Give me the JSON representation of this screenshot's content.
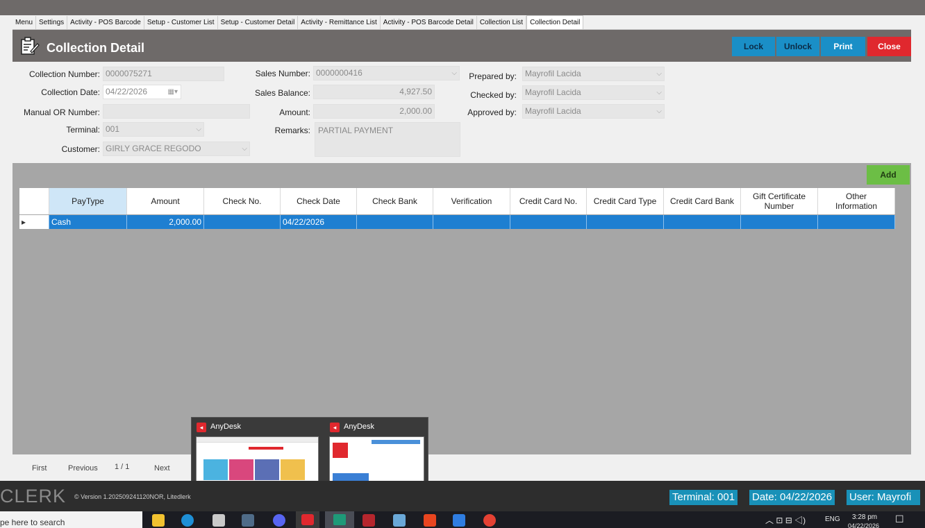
{
  "tabs": [
    "Menu",
    "Settings",
    "Activity - POS Barcode",
    "Setup - Customer List",
    "Setup - Customer Detail",
    "Activity - Remittance List",
    "Activity - POS Barcode Detail",
    "Collection List",
    "Collection Detail"
  ],
  "header": {
    "title": "Collection Detail",
    "buttons": {
      "lock": "Lock",
      "unlock": "Unlock",
      "print": "Print",
      "close": "Close"
    },
    "colors": {
      "lock": "#1a8fc7",
      "close": "#e0282e"
    }
  },
  "form": {
    "collection_number": {
      "label": "Collection Number:",
      "value": "0000075271"
    },
    "collection_date": {
      "label": "Collection Date:",
      "value": "04/22/2026"
    },
    "manual_or_number": {
      "label": "Manual OR Number:",
      "value": ""
    },
    "terminal": {
      "label": "Terminal:",
      "value": "001"
    },
    "customer": {
      "label": "Customer:",
      "value": "GIRLY GRACE REGODO"
    },
    "sales_number": {
      "label": "Sales Number:",
      "value": "0000000416"
    },
    "sales_balance": {
      "label": "Sales Balance:",
      "value": "4,927.50"
    },
    "amount": {
      "label": "Amount:",
      "value": "2,000.00"
    },
    "remarks": {
      "label": "Remarks:",
      "value": "PARTIAL PAYMENT"
    },
    "prepared_by": {
      "label": "Prepared by:",
      "value": "Mayrofil Lacida"
    },
    "checked_by": {
      "label": "Checked by:",
      "value": "Mayrofil Lacida"
    },
    "approved_by": {
      "label": "Approved by:",
      "value": "Mayrofil Lacida"
    }
  },
  "grid": {
    "add_label": "Add",
    "columns": [
      "PayType",
      "Amount",
      "Check No.",
      "Check Date",
      "Check Bank",
      "Verification",
      "Credit Card No.",
      "Credit Card Type",
      "Credit Card Bank",
      "Gift Certificate Number",
      "Other Information"
    ],
    "rows": [
      {
        "pointer": "▸",
        "cells": [
          "Cash",
          "2,000.00",
          "",
          "04/22/2026",
          "",
          "",
          "",
          "",
          "",
          "",
          ""
        ]
      }
    ]
  },
  "pager": {
    "first": "First",
    "previous": "Previous",
    "page": "1 / 1",
    "next": "Next"
  },
  "anydesk": {
    "items": [
      {
        "title": "AnyDesk"
      },
      {
        "title": "AnyDesk"
      }
    ]
  },
  "status": {
    "brand": "CLERK",
    "version": "© Version 1.202509241120NOR, Litedlerk",
    "terminal": "Terminal: 001",
    "date": "Date: 04/22/2026",
    "user": "User: Mayrofi"
  },
  "taskbar": {
    "search_placeholder": "pe here to search",
    "tray_lang": "ENG",
    "time": "3:28 pm",
    "date": "04/22/2026"
  }
}
